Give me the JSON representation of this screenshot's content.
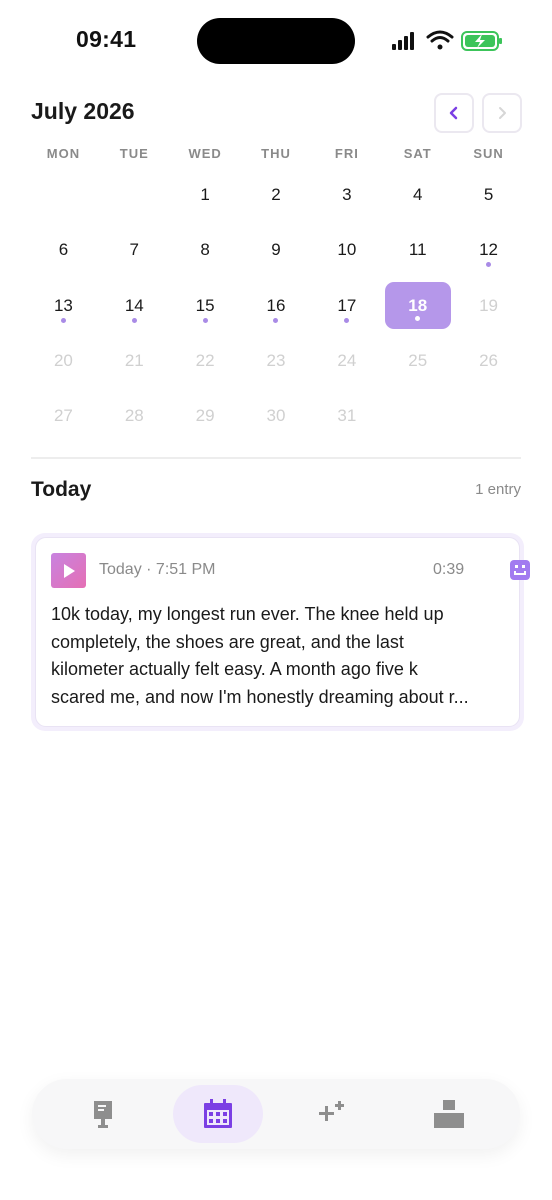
{
  "status_bar": {
    "time": "09:41"
  },
  "calendar": {
    "month_title": "July 2026",
    "prev_icon": "chevron-left-icon",
    "next_icon": "chevron-right-icon",
    "weekdays": [
      "MON",
      "TUE",
      "WED",
      "THU",
      "FRI",
      "SAT",
      "SUN"
    ],
    "leading_blanks": 2,
    "days": [
      {
        "label": "1",
        "dot": false,
        "muted": false
      },
      {
        "label": "2",
        "dot": false,
        "muted": false
      },
      {
        "label": "3",
        "dot": false,
        "muted": false
      },
      {
        "label": "4",
        "dot": false,
        "muted": false
      },
      {
        "label": "5",
        "dot": false,
        "muted": false
      },
      {
        "label": "6",
        "dot": false,
        "muted": false
      },
      {
        "label": "7",
        "dot": false,
        "muted": false
      },
      {
        "label": "8",
        "dot": false,
        "muted": false
      },
      {
        "label": "9",
        "dot": false,
        "muted": false
      },
      {
        "label": "10",
        "dot": false,
        "muted": false
      },
      {
        "label": "11",
        "dot": false,
        "muted": false
      },
      {
        "label": "12",
        "dot": true,
        "muted": false
      },
      {
        "label": "13",
        "dot": true,
        "muted": false
      },
      {
        "label": "14",
        "dot": true,
        "muted": false
      },
      {
        "label": "15",
        "dot": true,
        "muted": false
      },
      {
        "label": "16",
        "dot": true,
        "muted": false
      },
      {
        "label": "17",
        "dot": true,
        "muted": false
      },
      {
        "label": "18",
        "dot": true,
        "muted": false,
        "selected": true
      },
      {
        "label": "19",
        "dot": false,
        "muted": true
      },
      {
        "label": "20",
        "dot": false,
        "muted": true
      },
      {
        "label": "21",
        "dot": false,
        "muted": true
      },
      {
        "label": "22",
        "dot": false,
        "muted": true
      },
      {
        "label": "23",
        "dot": false,
        "muted": true
      },
      {
        "label": "24",
        "dot": false,
        "muted": true
      },
      {
        "label": "25",
        "dot": false,
        "muted": true
      },
      {
        "label": "26",
        "dot": false,
        "muted": true
      },
      {
        "label": "27",
        "dot": false,
        "muted": true
      },
      {
        "label": "28",
        "dot": false,
        "muted": true
      },
      {
        "label": "29",
        "dot": false,
        "muted": true
      },
      {
        "label": "30",
        "dot": false,
        "muted": true
      },
      {
        "label": "31",
        "dot": false,
        "muted": true
      }
    ]
  },
  "today": {
    "title": "Today",
    "count": "1 entry"
  },
  "entry": {
    "play_icon": "play-icon",
    "meta": "Today · 7:51 PM",
    "duration": "0:39",
    "mood_icon": "smiley-icon",
    "text_lines": [
      "10k today, my longest run ever. The knee held up",
      "completely, the shoes are great, and the last",
      "kilometer actually felt easy. A month ago five k",
      "scared me, and now I'm honestly dreaming about r..."
    ]
  },
  "tab_bar": {
    "tabs": [
      {
        "icon": "journal-icon",
        "active": false
      },
      {
        "icon": "calendar-icon",
        "active": true
      },
      {
        "icon": "sparkles-icon",
        "active": false
      },
      {
        "icon": "profile-icon",
        "active": false
      }
    ]
  },
  "colors": {
    "accent": "#b597ea",
    "accent_dark": "#7b3fe4",
    "dot": "#a98be6",
    "muted_text": "#8a8a8a",
    "gradient_start": "#c883e0",
    "gradient_end": "#e56fb4"
  }
}
